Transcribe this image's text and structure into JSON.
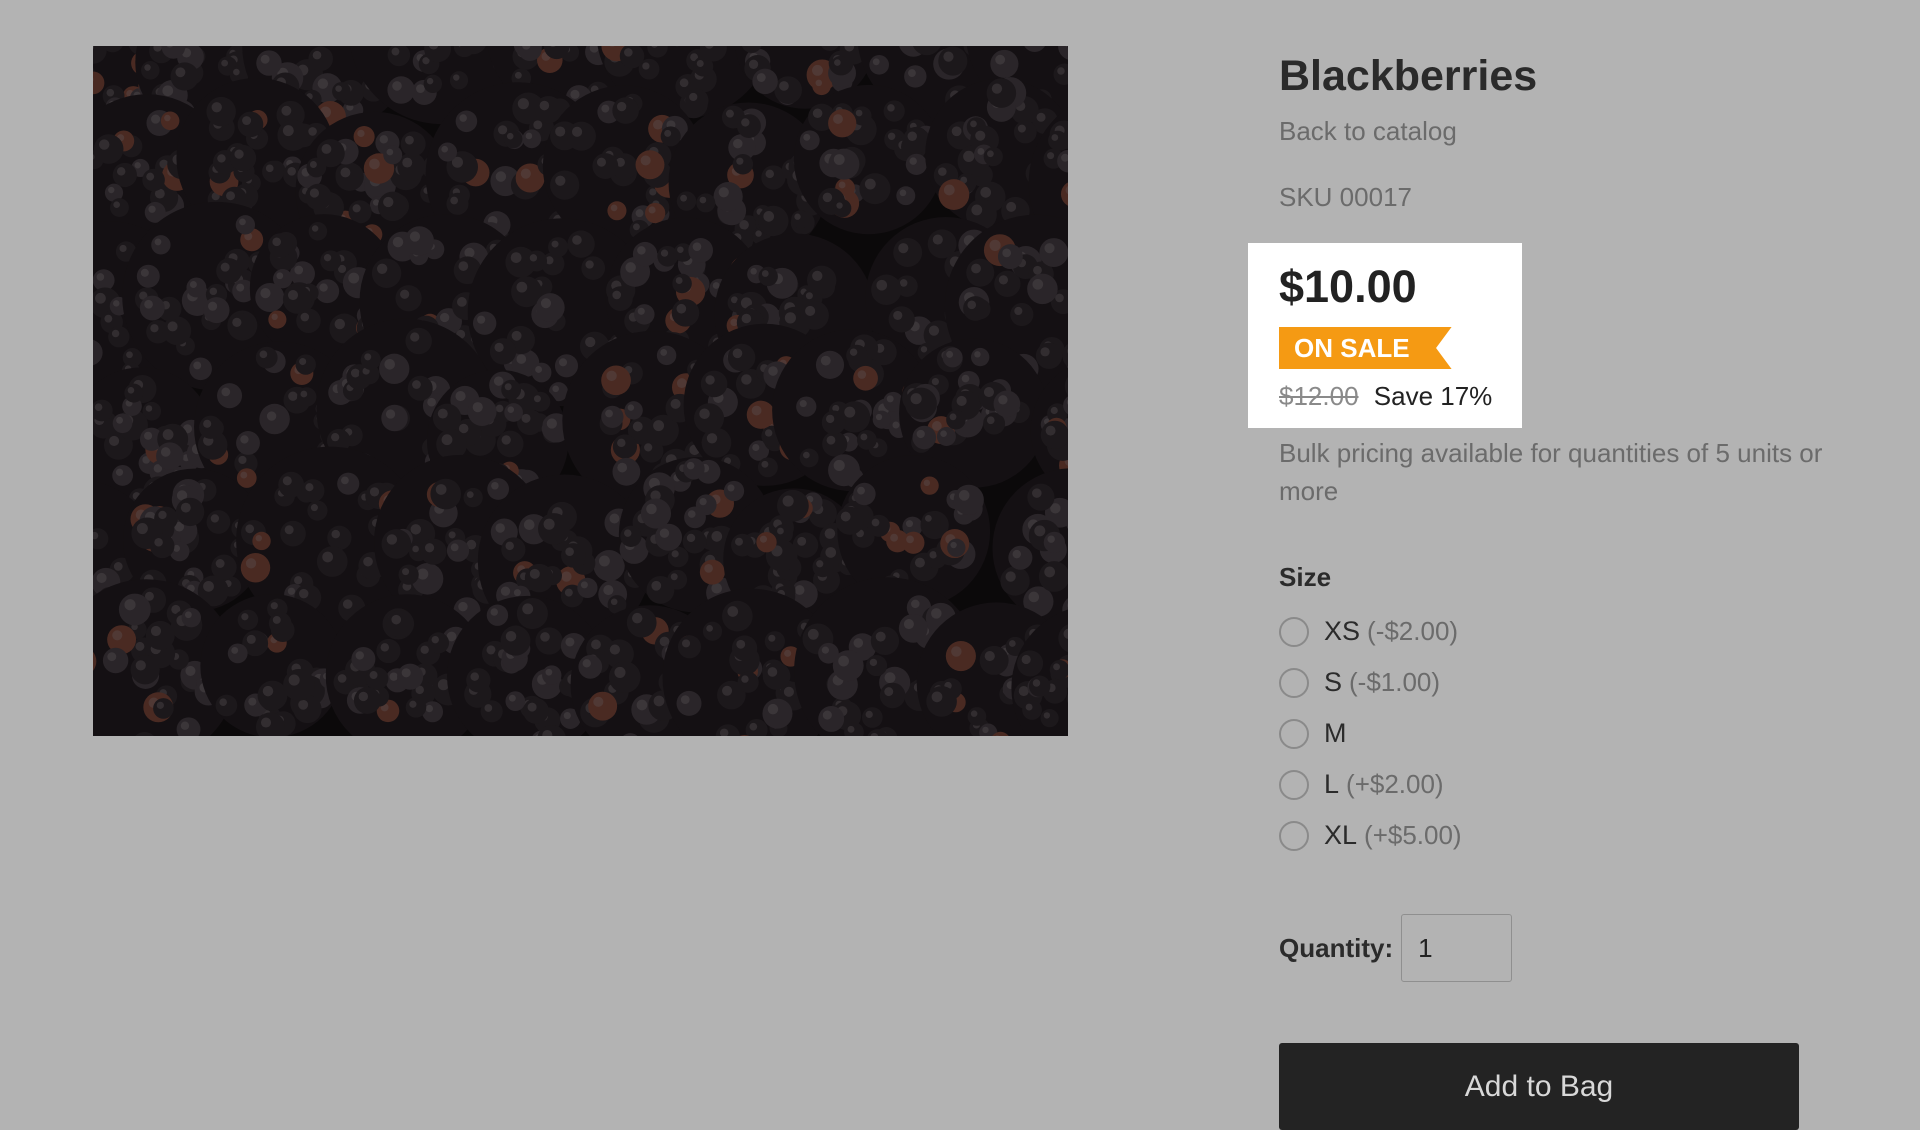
{
  "product": {
    "title": "Blackberries",
    "back_link": "Back to catalog",
    "sku": "SKU 00017",
    "image_icon": "blackberries-photo"
  },
  "pricing": {
    "price": "$10.00",
    "badge": "ON SALE",
    "original_price": "$12.00",
    "savings": "Save 17%",
    "badge_color": "#f59a13"
  },
  "bulk_note": "Bulk pricing available for quantities of 5 units or more",
  "size": {
    "label": "Size",
    "options": [
      {
        "name": "XS",
        "modifier": "(-$2.00)"
      },
      {
        "name": "S",
        "modifier": "(-$1.00)"
      },
      {
        "name": "M",
        "modifier": ""
      },
      {
        "name": "L",
        "modifier": "(+$2.00)"
      },
      {
        "name": "XL",
        "modifier": "(+$5.00)"
      }
    ]
  },
  "quantity": {
    "label": "Quantity:",
    "value": "1"
  },
  "add_button": {
    "label": "Add to Bag",
    "color": "#232323"
  }
}
